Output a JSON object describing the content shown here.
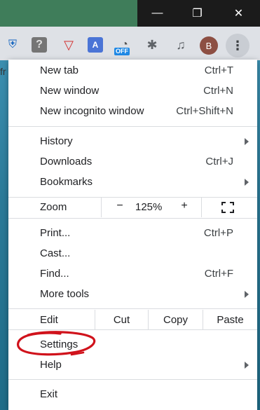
{
  "window": {
    "minimize_glyph": "—",
    "maximize_glyph": "❐",
    "close_glyph": "✕"
  },
  "toolbar": {
    "extensions": [
      {
        "icon": "shield-extension-icon",
        "glyph": "⛨"
      },
      {
        "icon": "help-extension-icon",
        "glyph": "?"
      },
      {
        "icon": "vivaldi-shield-icon",
        "glyph": "▽"
      },
      {
        "icon": "translate-icon",
        "glyph": "A"
      },
      {
        "icon": "speedometer-icon",
        "glyph": "◔"
      },
      {
        "icon": "puzzle-icon",
        "glyph": "✱"
      },
      {
        "icon": "media-queue-icon",
        "glyph": "♫"
      }
    ],
    "off_badge": "OFF",
    "profile_initial": "B",
    "menu_glyph": "⋮",
    "page_peek_text": "fr"
  },
  "menu": {
    "new_tab": {
      "label": "New tab",
      "shortcut": "Ctrl+T"
    },
    "new_window": {
      "label": "New window",
      "shortcut": "Ctrl+N"
    },
    "new_incognito": {
      "label": "New incognito window",
      "shortcut": "Ctrl+Shift+N"
    },
    "history": {
      "label": "History"
    },
    "downloads": {
      "label": "Downloads",
      "shortcut": "Ctrl+J"
    },
    "bookmarks": {
      "label": "Bookmarks"
    },
    "zoom": {
      "label": "Zoom",
      "minus": "−",
      "value": "125%",
      "plus": "+"
    },
    "print": {
      "label": "Print...",
      "shortcut": "Ctrl+P"
    },
    "cast": {
      "label": "Cast..."
    },
    "find": {
      "label": "Find...",
      "shortcut": "Ctrl+F"
    },
    "more_tools": {
      "label": "More tools"
    },
    "edit": {
      "label": "Edit",
      "cut": "Cut",
      "copy": "Copy",
      "paste": "Paste"
    },
    "settings": {
      "label": "Settings"
    },
    "help": {
      "label": "Help"
    },
    "exit": {
      "label": "Exit"
    }
  },
  "colors": {
    "accent_annotation": "#d0121b",
    "menu_background": "#ffffff",
    "window_controls": "#1b1b1b"
  }
}
